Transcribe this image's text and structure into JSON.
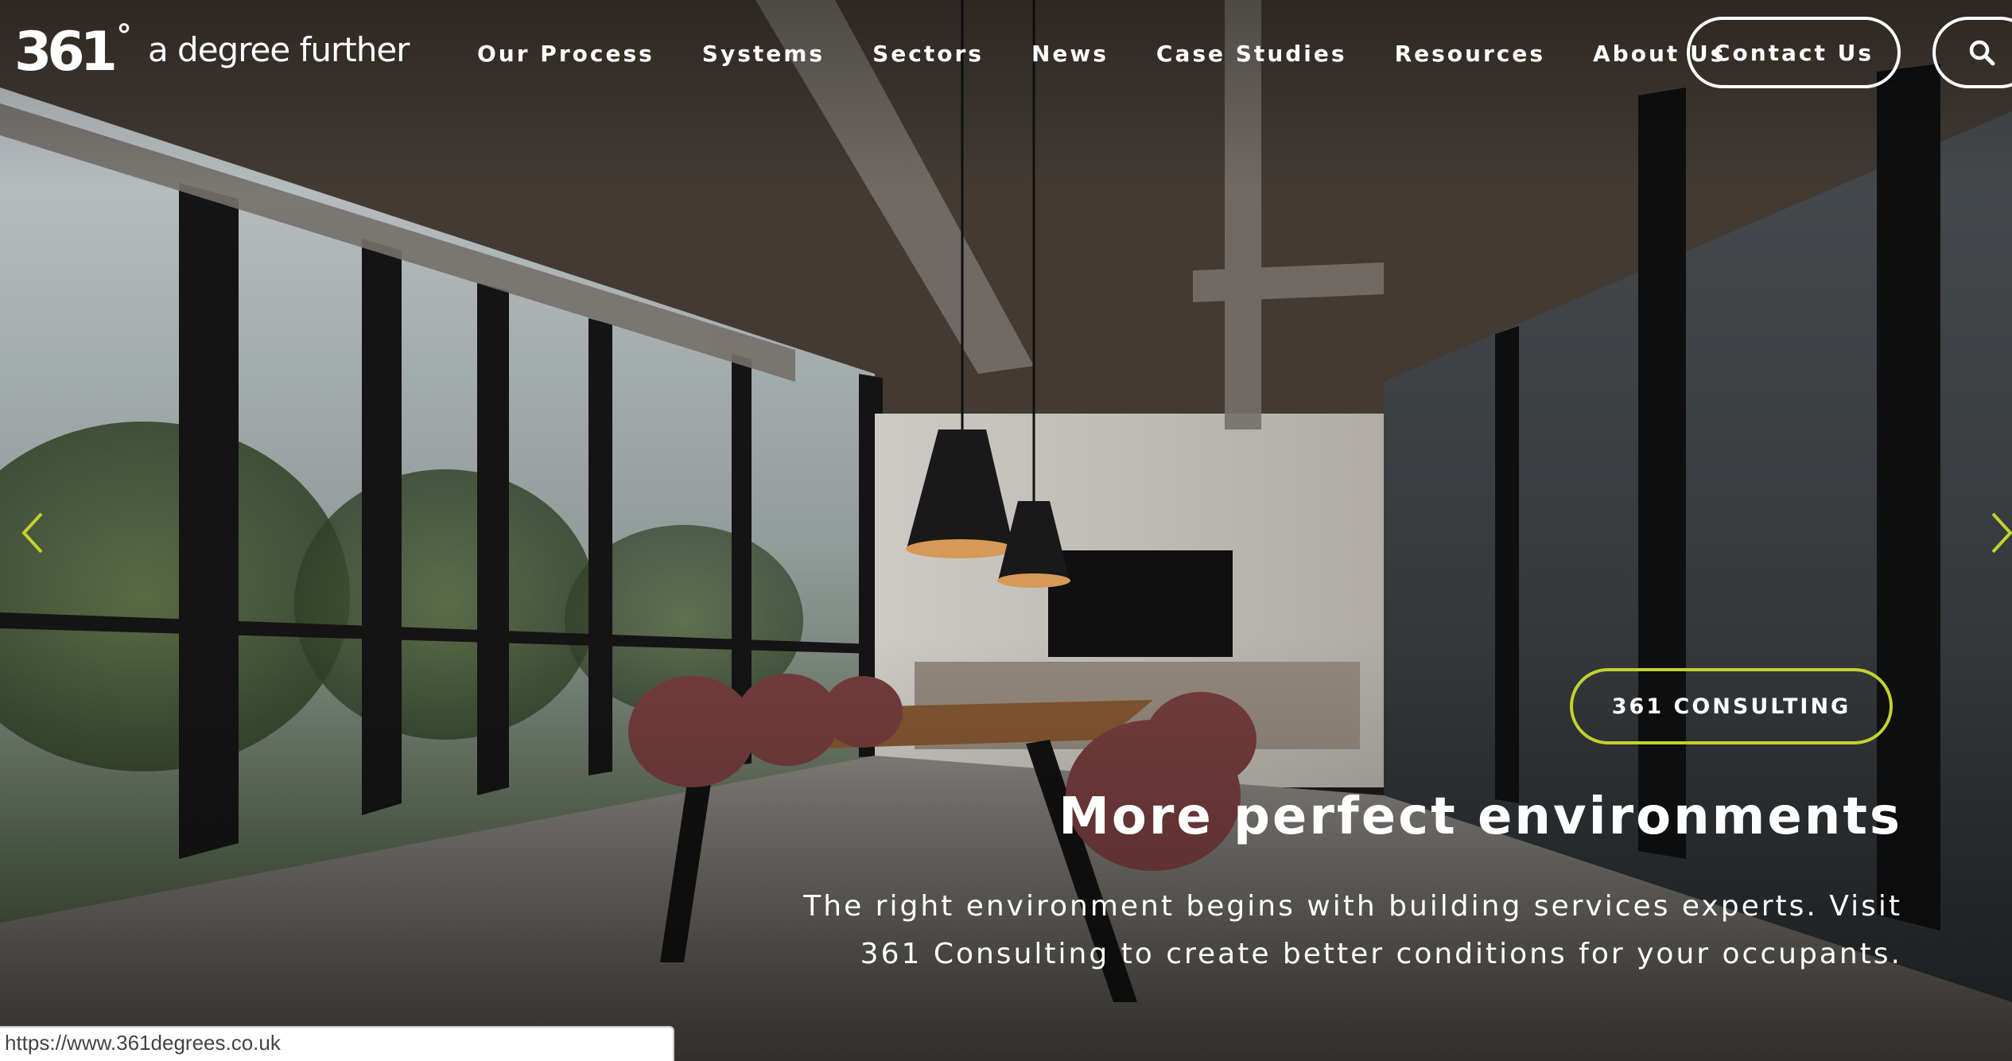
{
  "header": {
    "logo": {
      "mark": "361",
      "degree": "°",
      "tagline": "a degree further"
    },
    "nav": [
      {
        "label": "Our Process"
      },
      {
        "label": "Systems"
      },
      {
        "label": "Sectors"
      },
      {
        "label": "News"
      },
      {
        "label": "Case Studies"
      },
      {
        "label": "Resources"
      },
      {
        "label": "About Us"
      }
    ],
    "contact_label": "Contact Us",
    "search_icon": "search-icon"
  },
  "slider": {
    "prev_icon": "chevron-left-icon",
    "next_icon": "chevron-right-icon",
    "accent_color": "#c3d12f",
    "badge": "361 CONSULTING",
    "headline": "More perfect environments",
    "body": "The right environment begins with building services experts. Visit 361 Consulting to create better conditions for your occupants."
  },
  "status_bar": {
    "url": "https://www.361degrees.co.uk"
  }
}
